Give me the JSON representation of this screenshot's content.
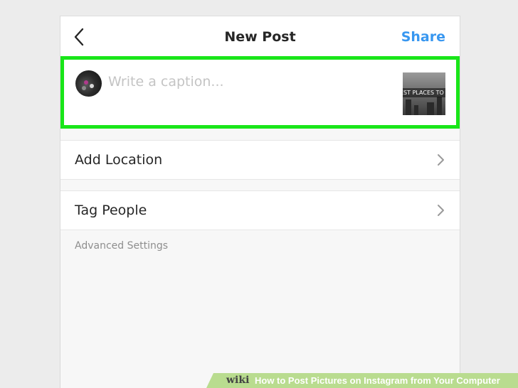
{
  "header": {
    "title": "New Post",
    "share_label": "Share",
    "back_icon": "chevron-left-icon"
  },
  "caption": {
    "placeholder": "Write a caption...",
    "value": "",
    "thumbnail_text": "EST PLACES TO TRAV",
    "highlight_color": "#19e619"
  },
  "rows": [
    {
      "label": "Add Location",
      "icon": "chevron-right-icon"
    },
    {
      "label": "Tag People",
      "icon": "chevron-right-icon"
    }
  ],
  "advanced_settings_label": "Advanced Settings",
  "banner": {
    "brand": "wiki",
    "title": "How to Post Pictures on Instagram from Your Computer"
  },
  "colors": {
    "share_blue": "#3897f0",
    "text_dark": "#262626",
    "muted": "#8e8e8e"
  }
}
